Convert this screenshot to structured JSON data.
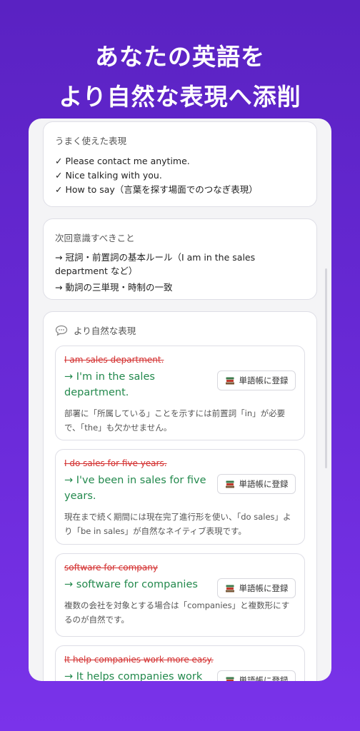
{
  "headline": {
    "line1": "あなたの英語を",
    "line2": "より自然な表現へ添削"
  },
  "good_expressions": {
    "title": "うまく使えた表現",
    "items": [
      "✓ Please contact me anytime.",
      "✓ Nice talking with you.",
      "✓ How to say（言葉を探す場面でのつなぎ表現）"
    ]
  },
  "next_focus": {
    "title": "次回意識すべきこと",
    "items": [
      "→ 冠詞・前置詞の基本ルール（I am in the sales department など）",
      "→ 動詞の三単現・時制の一致"
    ]
  },
  "natural_expressions": {
    "title": "より自然な表現",
    "icon": "speech-bubble-icon",
    "register_label": "単語帳に登録",
    "register_icon": "books-icon",
    "corrections": [
      {
        "original": "I am sales department.",
        "corrected": "→ I'm in the sales department.",
        "explanation": "部署に「所属している」ことを示すには前置詞「in」が必要で、「the」も欠かせません。"
      },
      {
        "original": "I do sales for five years.",
        "corrected": "→ I've been in sales for five years.",
        "explanation": "現在まで続く期間には現在完了進行形を使い、「do sales」より「be in sales」が自然なネイティブ表現です。"
      },
      {
        "original": "software for company",
        "corrected": "→ software for companies",
        "explanation": "複数の会社を対象とする場合は「companies」と複数形にするのが自然です。"
      },
      {
        "original": "It help companies work more easy.",
        "corrected": "→ It helps companies work",
        "explanation": ""
      }
    ]
  },
  "colors": {
    "background_top": "#5a22c2",
    "background_bottom": "#7a33ea",
    "original_text": "#d32f2f",
    "corrected_text": "#23894d"
  }
}
